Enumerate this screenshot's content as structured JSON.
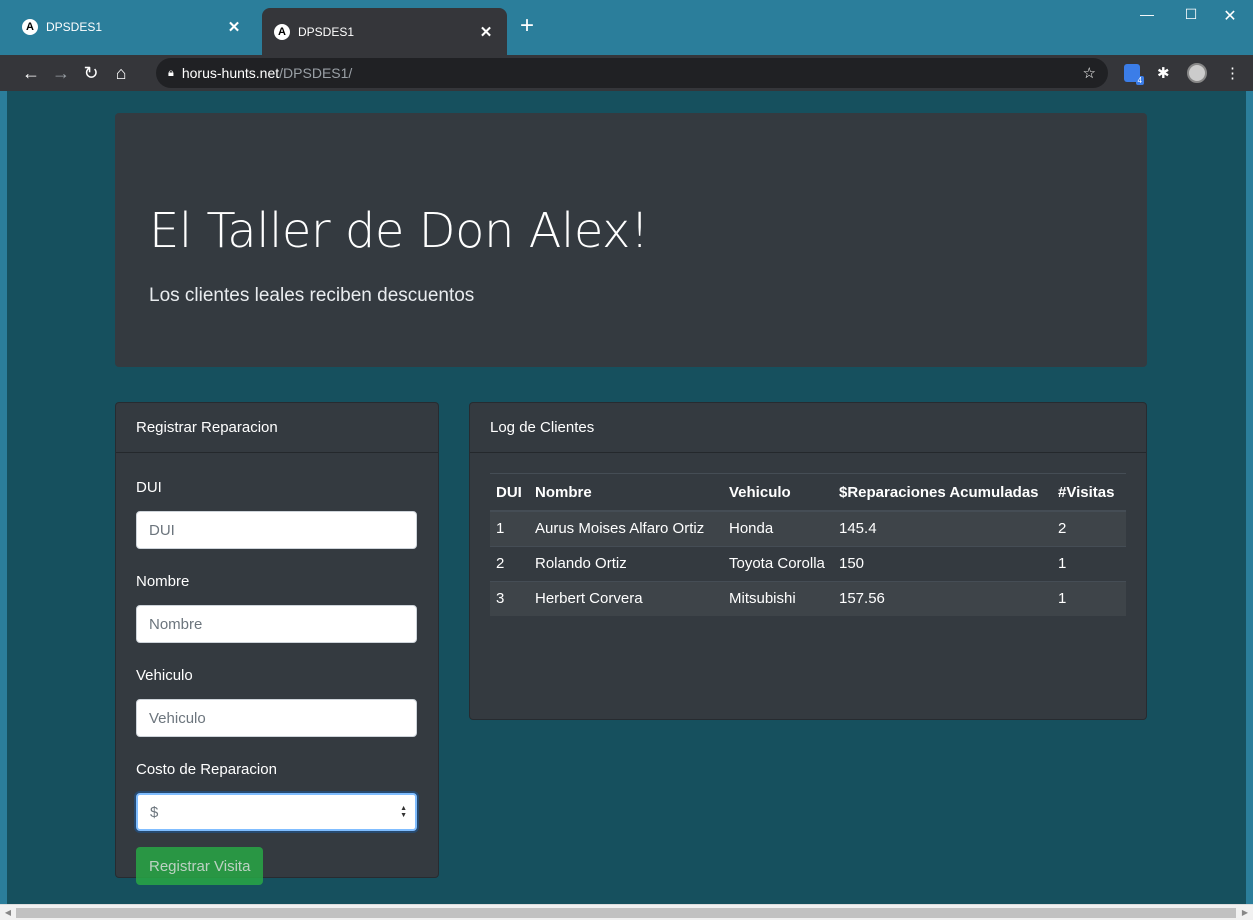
{
  "browser": {
    "tabs": [
      {
        "label": "DPSDES1",
        "favicon": "A"
      },
      {
        "label": "DPSDES1",
        "favicon": "A"
      }
    ],
    "url_host": "horus-hunts.net",
    "url_path": "/DPSDES1/",
    "extension_badge": "4"
  },
  "jumbotron": {
    "title": "El Taller de Don Alex!",
    "subtitle": "Los clientes leales reciben descuentos"
  },
  "form": {
    "header": "Registrar Reparacion",
    "fields": [
      {
        "label": "DUI",
        "placeholder": "DUI"
      },
      {
        "label": "Nombre",
        "placeholder": "Nombre"
      },
      {
        "label": "Vehiculo",
        "placeholder": "Vehiculo"
      },
      {
        "label": "Costo de Reparacion",
        "placeholder": "$"
      }
    ],
    "submit_label": "Registrar Visita"
  },
  "log": {
    "header": "Log de Clientes",
    "columns": [
      "DUI",
      "Nombre",
      "Vehiculo",
      "$Reparaciones Acumuladas",
      "#Visitas"
    ],
    "rows": [
      {
        "dui": "1",
        "nombre": "Aurus Moises Alfaro Ortiz",
        "vehiculo": "Honda",
        "reparaciones": "145.4",
        "visitas": "2"
      },
      {
        "dui": "2",
        "nombre": "Rolando Ortiz",
        "vehiculo": "Toyota Corolla",
        "reparaciones": "150",
        "visitas": "1"
      },
      {
        "dui": "3",
        "nombre": "Herbert Corvera",
        "vehiculo": "Mitsubishi",
        "reparaciones": "157.56",
        "visitas": "1"
      }
    ]
  },
  "colors": {
    "page_background": "#16505e",
    "card_background": "#343a40",
    "button": "#28a745",
    "chrome_frame": "#2b7e9b"
  }
}
